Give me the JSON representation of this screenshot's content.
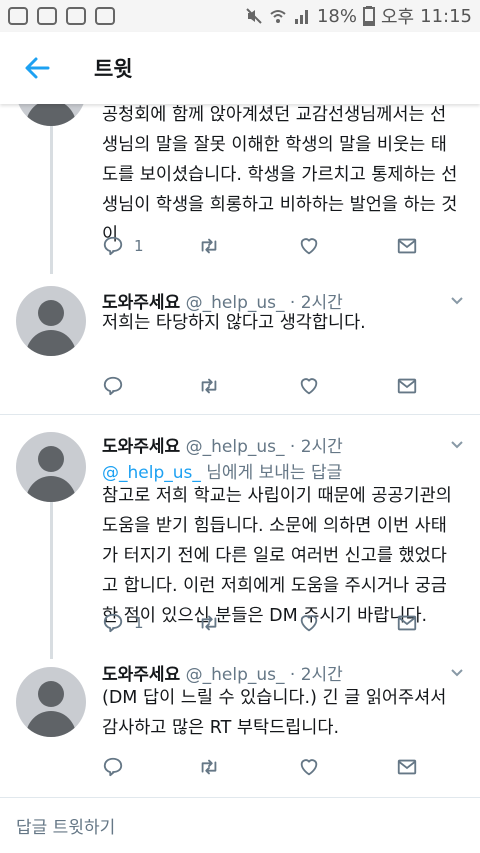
{
  "statusbar": {
    "battery_percent": "18%",
    "ampm": "오후",
    "time": "11:15"
  },
  "header": {
    "title": "트윗"
  },
  "tweets": [
    {
      "text": "공청회에 함께 앉아계셨던 교감선생님께서는 선생님의 말을 잘못 이해한 학생의 말을 비웃는 태도를 보이셨습니다. 학생을 가르치고 통제하는 선생님이 학생을 희롱하고 비하하는 발언을 하는 것이",
      "reply_count": "1"
    },
    {
      "name": "도와주세요",
      "handle": "@_help_us_",
      "time": "· 2시간",
      "text": "저희는 타당하지 않다고 생각합니다."
    },
    {
      "name": "도와주세요",
      "handle": "@_help_us_",
      "time": "· 2시간",
      "reply_to_mention": "@_help_us_",
      "reply_to_suffix": " 님에게 보내는 답글",
      "text": "참고로 저희 학교는 사립이기 때문에 공공기관의 도움을 받기 힘듭니다. 소문에 의하면 이번 사태가 터지기 전에 다른 일로 여러번 신고를 했었다고 합니다. 이런 저희에게 도움을 주시거나 궁금한 점이 있으신 분들은 DM 주시기 바랍니다.",
      "reply_count": "1"
    },
    {
      "name": "도와주세요",
      "handle": "@_help_us_",
      "time": "· 2시간",
      "text": "(DM 답이 느릴 수 있습니다.) 긴 글 읽어주셔서 감사하고 많은 RT 부탁드립니다."
    }
  ],
  "reply_bar": {
    "placeholder": "답글 트윗하기"
  },
  "colors": {
    "accent": "#1da1f2",
    "muted": "#657786",
    "avatar_bg": "#c9ccd1",
    "avatar_fg": "#5f6367"
  }
}
